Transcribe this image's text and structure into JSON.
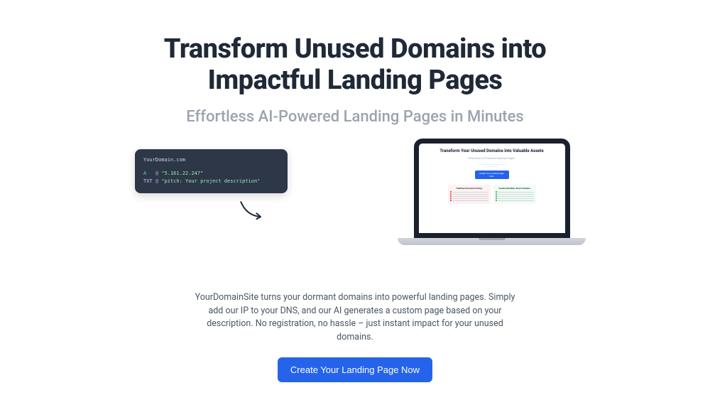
{
  "hero": {
    "title": "Transform Unused Domains into Impactful Landing Pages",
    "subtitle": "Effortless AI-Powered Landing Pages in Minutes"
  },
  "dns": {
    "domain": "YourDomain.com",
    "record_a_type": "A",
    "record_txt_type": "TXT",
    "at": "@",
    "a_value": "\"5.161.22.247\"",
    "txt_value": "\"pitch: Your project description\""
  },
  "laptop": {
    "title": "Transform Your Unused Domains into Valuable Assets",
    "subtitle": "Effortless AI-Powered Parking Pages",
    "button": "Create Your Landing Page Now",
    "card_red_title": "Traditional Domain Parking",
    "card_green_title": "YourDomainSite's Smart Solution"
  },
  "description": "YourDomainSite turns your dormant domains into powerful landing pages. Simply add our IP to your DNS, and our AI generates a custom page based on your description. No registration, no hassle – just instant impact for your unused domains.",
  "cta": {
    "label": "Create Your Landing Page Now"
  }
}
